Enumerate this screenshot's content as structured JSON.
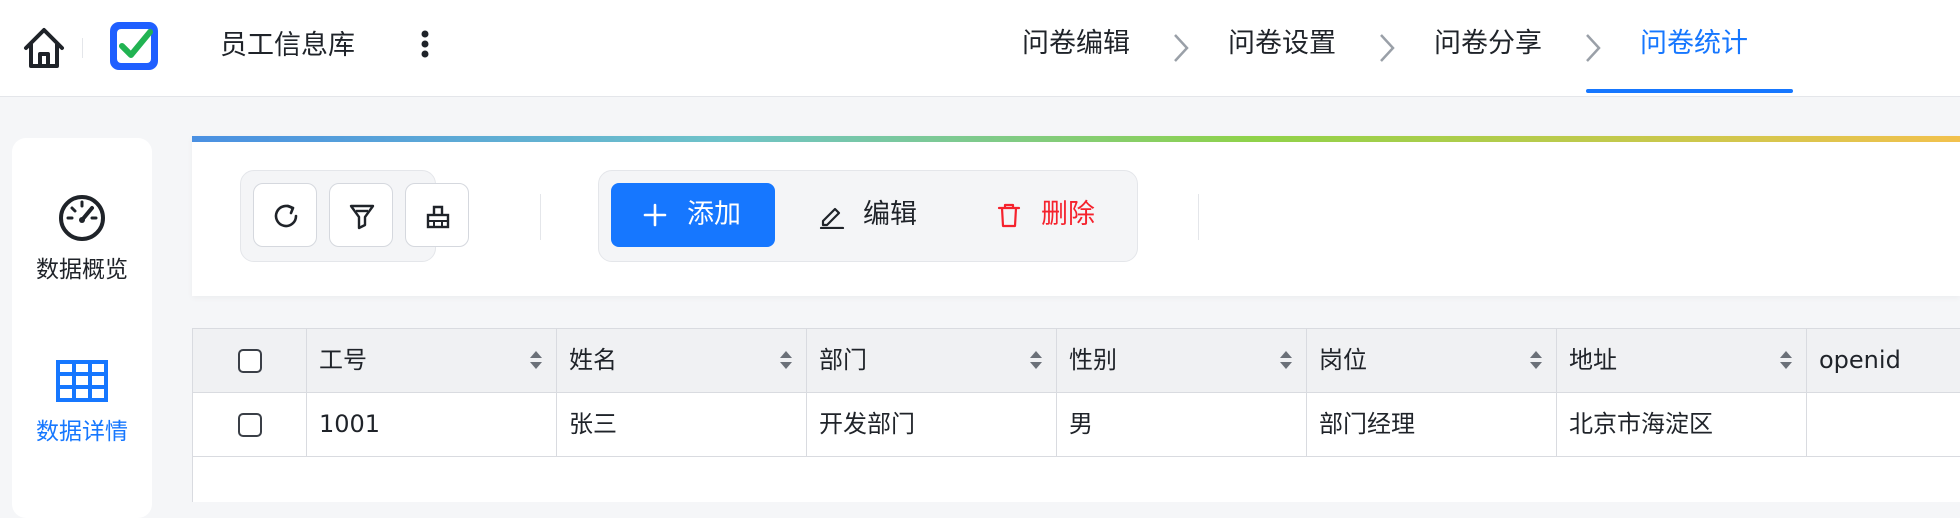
{
  "header": {
    "app_name": "员工信息库",
    "steps": [
      {
        "label": "问卷编辑",
        "active": false
      },
      {
        "label": "问卷设置",
        "active": false
      },
      {
        "label": "问卷分享",
        "active": false
      },
      {
        "label": "问卷统计",
        "active": true
      }
    ]
  },
  "sidebar": {
    "items": [
      {
        "label": "数据概览",
        "icon": "dashboard-gauge-icon",
        "active": false
      },
      {
        "label": "数据详情",
        "icon": "table-grid-icon",
        "active": true
      }
    ]
  },
  "toolbar": {
    "icon_buttons": [
      "refresh-icon",
      "filter-icon",
      "clear-icon"
    ],
    "add_label": "添加",
    "edit_label": "编辑",
    "delete_label": "删除"
  },
  "table": {
    "columns": [
      "工号",
      "姓名",
      "部门",
      "性别",
      "岗位",
      "地址",
      "openid"
    ],
    "rows": [
      [
        "1001",
        "张三",
        "开发部门",
        "男",
        "部门经理",
        "北京市海淀区",
        ""
      ]
    ]
  },
  "colors": {
    "accent": "#1677ff",
    "danger": "#f5222d",
    "text": "#1f2329"
  }
}
